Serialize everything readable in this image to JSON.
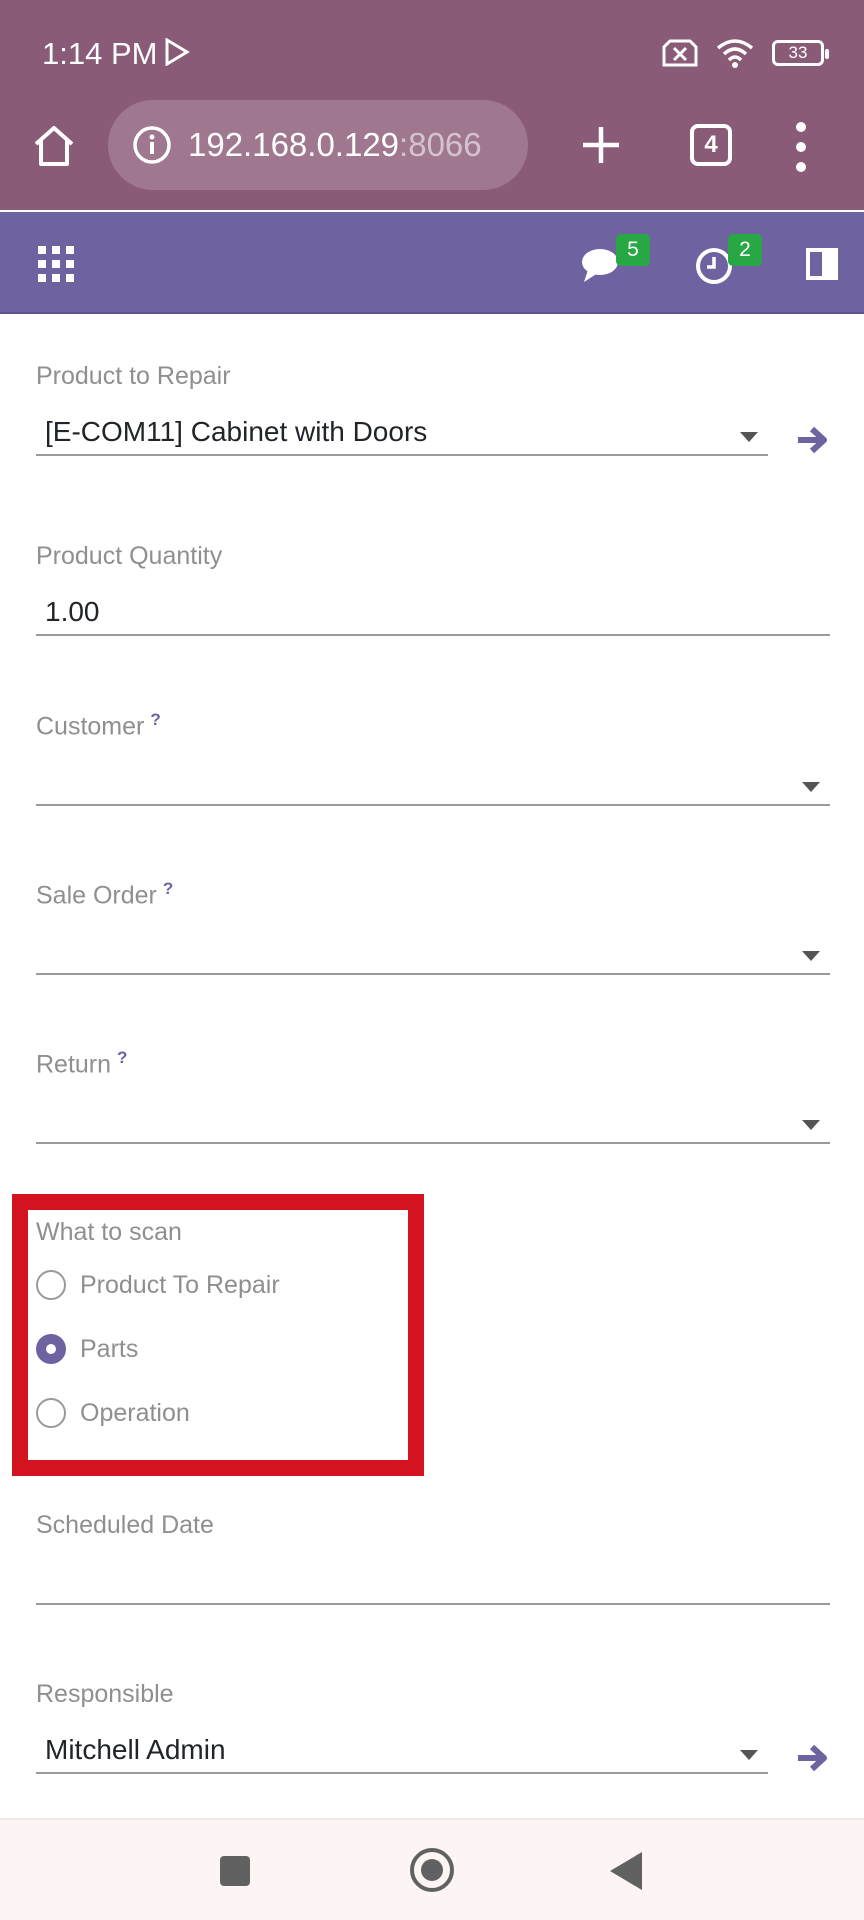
{
  "status_bar": {
    "time": "1:14 PM",
    "battery": "33"
  },
  "browser": {
    "url_host": "192.168.0.129",
    "url_port": ":8066",
    "tab_count": "4"
  },
  "navbar": {
    "messages_badge": "5",
    "activities_badge": "2"
  },
  "form": {
    "product_to_repair": {
      "label": "Product to Repair",
      "value": "[E-COM11] Cabinet with Doors"
    },
    "product_quantity": {
      "label": "Product Quantity",
      "value": "1.00"
    },
    "customer": {
      "label": "Customer",
      "help": "?",
      "value": ""
    },
    "sale_order": {
      "label": "Sale Order",
      "help": "?",
      "value": ""
    },
    "return": {
      "label": "Return",
      "help": "?",
      "value": ""
    },
    "what_to_scan": {
      "label": "What to scan",
      "options": [
        {
          "label": "Product To Repair",
          "checked": false
        },
        {
          "label": "Parts",
          "checked": true
        },
        {
          "label": "Operation",
          "checked": false
        }
      ]
    },
    "scheduled_date": {
      "label": "Scheduled Date",
      "value": ""
    },
    "responsible": {
      "label": "Responsible",
      "value": "Mitchell Admin"
    }
  },
  "colors": {
    "browser_chrome": "#8a5b77",
    "odoo_primary": "#6f62a0",
    "badge_green": "#28a745",
    "highlight_red": "#d3131f"
  }
}
